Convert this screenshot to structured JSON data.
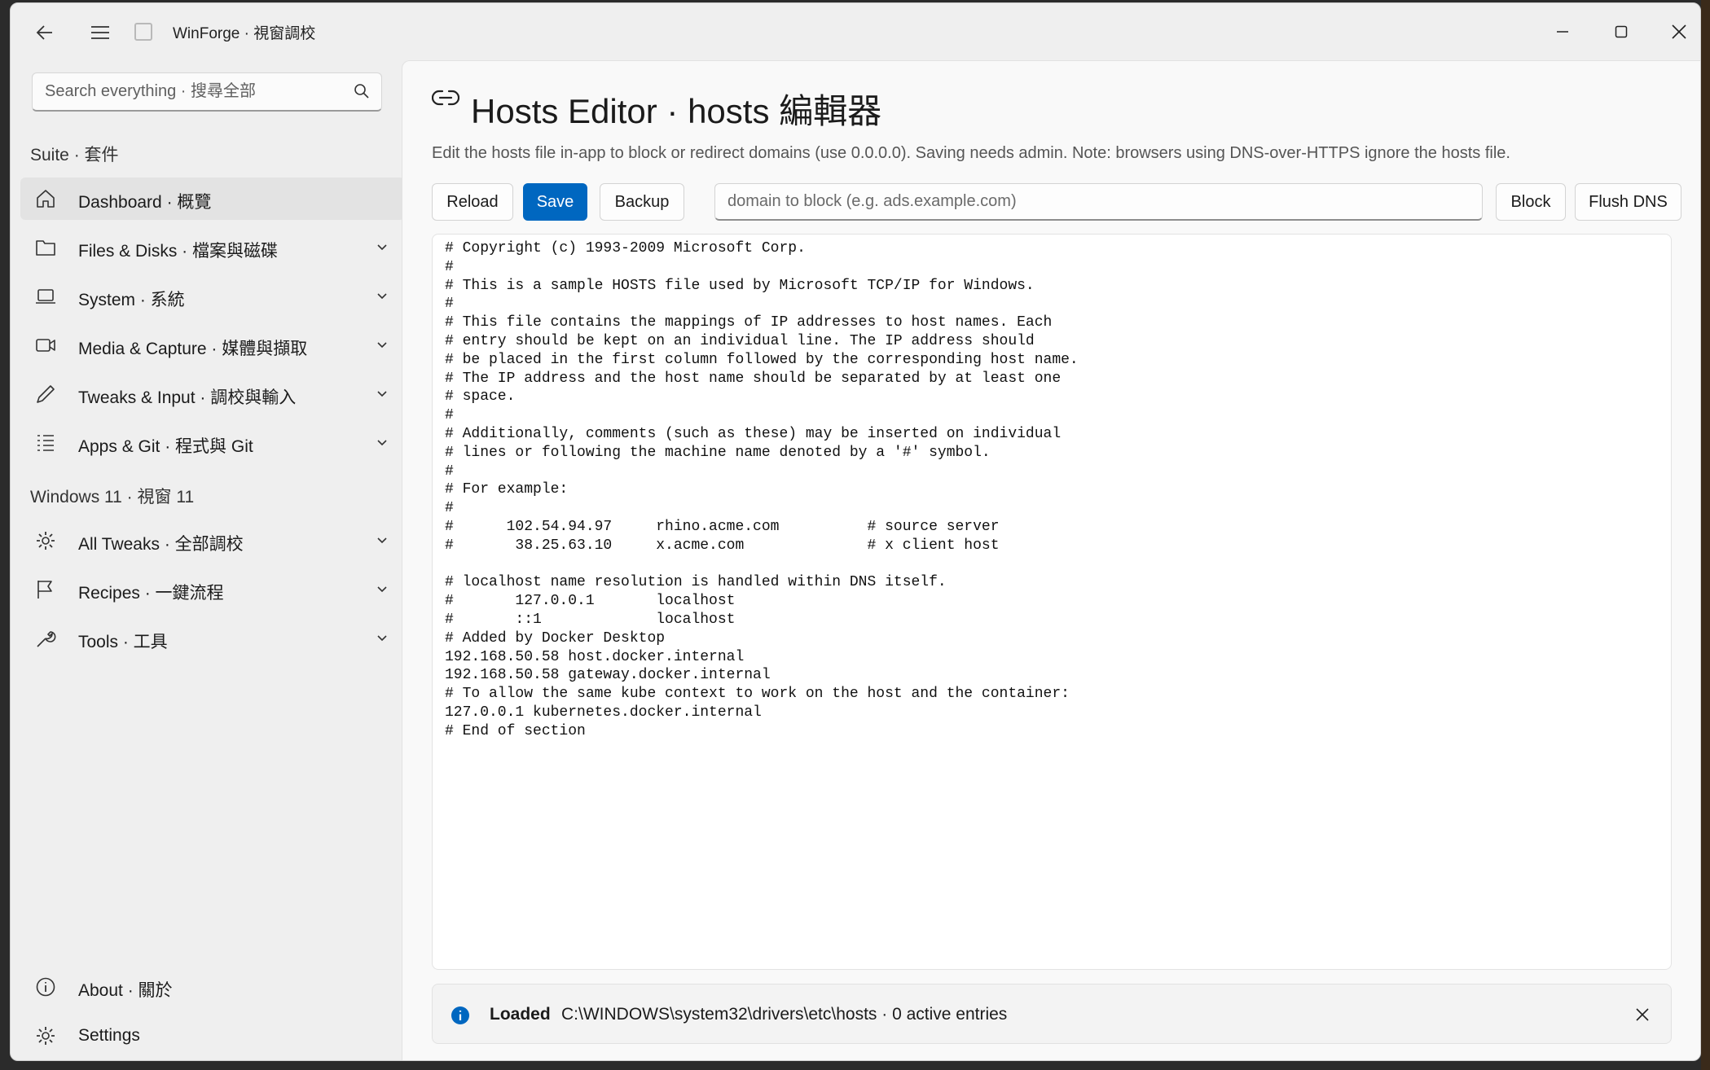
{
  "app": {
    "title": "WinForge · 視窗調校"
  },
  "search": {
    "placeholder": "Search everything · 搜尋全部"
  },
  "sidebar": {
    "sections": [
      "Suite · 套件",
      "Windows 11 · 視窗 11"
    ],
    "items": [
      {
        "label": "Dashboard · 概覽",
        "icon": "home-icon",
        "active": true
      },
      {
        "label": "Files & Disks · 檔案與磁碟",
        "icon": "folder-icon"
      },
      {
        "label": "System · 系統",
        "icon": "laptop-icon"
      },
      {
        "label": "Media & Capture · 媒體與擷取",
        "icon": "camera-icon"
      },
      {
        "label": "Tweaks & Input · 調校與輸入",
        "icon": "pen-icon"
      },
      {
        "label": "Apps & Git · 程式與 Git",
        "icon": "list-icon"
      },
      {
        "label": "All Tweaks · 全部調校",
        "icon": "gear-icon"
      },
      {
        "label": "Recipes · 一鍵流程",
        "icon": "flag-icon"
      },
      {
        "label": "Tools · 工具",
        "icon": "wrench-icon"
      }
    ],
    "footer": [
      {
        "label": "About · 關於",
        "icon": "info-icon"
      },
      {
        "label": "Settings",
        "icon": "gear-icon"
      }
    ]
  },
  "page": {
    "title": "Hosts Editor · hosts 編輯器",
    "description": "Edit the hosts file in-app to block or redirect domains (use 0.0.0.0). Saving needs admin. Note: browsers using DNS-over-HTTPS ignore the hosts file."
  },
  "toolbar": {
    "reload": "Reload",
    "save": "Save",
    "backup": "Backup",
    "domain_placeholder": "domain to block (e.g. ads.example.com)",
    "block": "Block",
    "flush": "Flush DNS"
  },
  "hosts_content": "# Copyright (c) 1993-2009 Microsoft Corp.\n#\n# This is a sample HOSTS file used by Microsoft TCP/IP for Windows.\n#\n# This file contains the mappings of IP addresses to host names. Each\n# entry should be kept on an individual line. The IP address should\n# be placed in the first column followed by the corresponding host name.\n# The IP address and the host name should be separated by at least one\n# space.\n#\n# Additionally, comments (such as these) may be inserted on individual\n# lines or following the machine name denoted by a '#' symbol.\n#\n# For example:\n#\n#      102.54.94.97     rhino.acme.com          # source server\n#       38.25.63.10     x.acme.com              # x client host\n\n# localhost name resolution is handled within DNS itself.\n#\t127.0.0.1       localhost\n#\t::1             localhost\n# Added by Docker Desktop\n192.168.50.58 host.docker.internal\n192.168.50.58 gateway.docker.internal\n# To allow the same kube context to work on the host and the container:\n127.0.0.1 kubernetes.docker.internal\n# End of section",
  "status": {
    "title": "Loaded",
    "message": "C:\\WINDOWS\\system32\\drivers\\etc\\hosts · 0 active entries"
  },
  "colors": {
    "accent": "#0067c0",
    "info": "#0067c0"
  }
}
